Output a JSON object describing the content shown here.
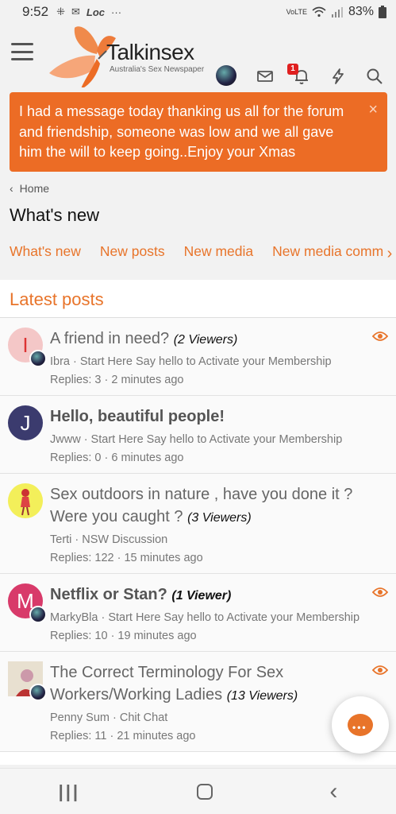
{
  "status_bar": {
    "time": "9:52",
    "notification_icons": [
      "grid-icon",
      "mail-icon",
      "loc-icon",
      "more-dots"
    ],
    "loc_label": "Loc",
    "more": "···",
    "network": "VoLTE",
    "battery": "83%"
  },
  "header": {
    "brand": "Talkinsex",
    "tagline": "Australia's Sex Newspaper",
    "alert_count": "1"
  },
  "notice": {
    "text": "I had a message today thanking us all for the forum and friendship, someone was low and we all gave him the will to keep going..Enjoy your Xmas",
    "close": "×"
  },
  "breadcrumb": {
    "chevron": "‹",
    "home": "Home"
  },
  "page_title": "What's new",
  "tabs": [
    {
      "label": "What's new"
    },
    {
      "label": "New posts"
    },
    {
      "label": "New media"
    },
    {
      "label": "New media comments"
    }
  ],
  "tabs_arrow": "›",
  "latest_posts": {
    "title": "Latest posts",
    "threads": [
      {
        "avatar_letter": "I",
        "title": "A friend in need?",
        "viewers": "(2 Viewers)",
        "meta": "Ibra · Start Here Say hello to Activate your Membership",
        "replies": "Replies: 3 · 2 minutes ago"
      },
      {
        "avatar_letter": "J",
        "title": "Hello, beautiful people!",
        "viewers": "",
        "meta": "Jwww · Start Here Say hello to Activate your Membership",
        "replies": "Replies: 0 · 6 minutes ago"
      },
      {
        "avatar_letter": "",
        "title": "Sex outdoors in nature , have you done it ? Were you caught ?",
        "viewers": "(3 Viewers)",
        "meta": "Terti · NSW Discussion",
        "replies": "Replies: 122 · 15 minutes ago"
      },
      {
        "avatar_letter": "M",
        "title": "Netflix or Stan?",
        "viewers": "(1 Viewer)",
        "meta": "MarkyBla · Start Here Say hello to Activate your Membership",
        "replies": "Replies: 10 · 19 minutes ago"
      },
      {
        "avatar_letter": "",
        "title": "The Correct Terminology For Sex Workers/Working Ladies",
        "viewers": "(13 Viewers)",
        "meta": "Penny Sum · Chit Chat",
        "replies": "Replies: 11 · 21 minutes ago"
      }
    ]
  },
  "chat_fab": {
    "dots": "•••"
  },
  "nav": {
    "recent": "|||",
    "back": "‹"
  },
  "colors": {
    "accent": "#e8742a",
    "notice_bg": "#ec6c25",
    "badge": "#e02020"
  }
}
